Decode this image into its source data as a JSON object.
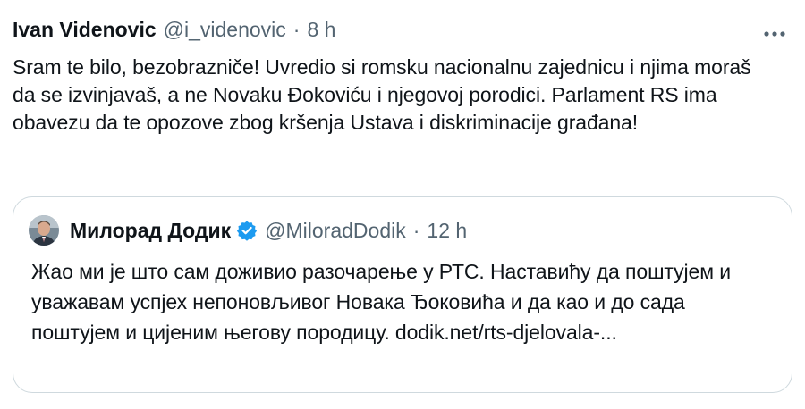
{
  "tweet": {
    "author_name": "Ivan Videnovic",
    "author_handle": "@i_videnovic",
    "separator": "·",
    "time": "8 h",
    "text": "Sram te bilo, bezobrazniče! Uvredio si romsku nacionalnu zajednicu i njima moraš da se izvinjavaš, a ne Novaku Đokoviću i njegovoj porodici. Parlament RS ima obavezu da te opozove zbog kršenja Ustava i diskriminacije građana!",
    "more_icon": "more-horizontal-icon"
  },
  "quote": {
    "author_name": "Милорад Додик",
    "verified_icon": "verified-badge-icon",
    "verified_color": "#1d9bf0",
    "author_handle": "@MiloradDodik",
    "separator": "·",
    "time": "12 h",
    "text": "Жао ми је што сам доживио разочарење у РТС. Наставићу да поштујем и уважавам успјех непоновљивог Новака Ђоковића и да као и до сада поштујем и цијеним његову породицу. dodik.net/rts-djelovala-..."
  },
  "colors": {
    "text_primary": "#0f1419",
    "text_secondary": "#536471",
    "border": "#cfd9de"
  }
}
